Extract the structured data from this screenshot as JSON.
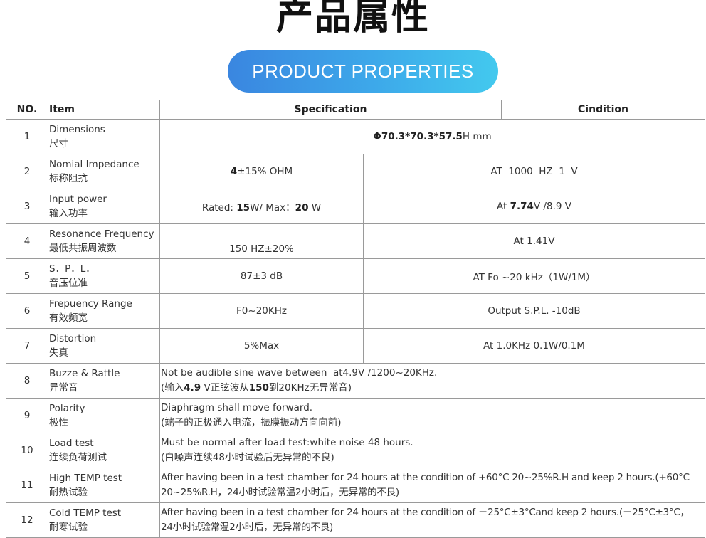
{
  "title_cn": "产品属性",
  "title_en": "PRODUCT PROPERTIES",
  "headers": {
    "no": "NO.",
    "item": "Item",
    "spec": "Specification",
    "cond": "Cindition"
  },
  "rows": [
    {
      "no": "1",
      "item_en": "Dimensions",
      "item_cn": "尺寸",
      "spec_bold": "Φ70.3*70.3*57.5",
      "spec_rest": "H mm"
    },
    {
      "no": "2",
      "item_en": "Nomial Impedance",
      "item_cn": "标称阻抗",
      "spec_bold": "4",
      "spec_rest": "±15% OHM",
      "cond": "AT  1000  HZ  1  V"
    },
    {
      "no": "3",
      "item_en": "Input power",
      "item_cn": "输入功率",
      "spec_a": "Rated: ",
      "spec_b": "15",
      "spec_c": "W/ Max：",
      "spec_d": "20",
      "spec_e": " W",
      "cond_a": "At ",
      "cond_b": "7.74",
      "cond_c": "V /8.9 V"
    },
    {
      "no": "4",
      "item_en": "Resonance Frequency",
      "item_cn": "最低共振周波数",
      "spec": "150 HZ±20%",
      "cond": "At 1.41V"
    },
    {
      "no": "5",
      "item_en": "S．P．L．",
      "item_cn": "音压位准",
      "spec": "87±3 dB",
      "cond": "AT Fo ~20 kHz（1W/1M）"
    },
    {
      "no": "6",
      "item_en": "Frepuency Range",
      "item_cn": "有效频宽",
      "spec": "F0~20KHz",
      "cond": "Output S.P.L. -10dB"
    },
    {
      "no": "7",
      "item_en": "Distortion",
      "item_cn": "失真",
      "spec": "5%Max",
      "cond": "At 1.0KHz 0.1W/0.1M"
    },
    {
      "no": "8",
      "item_en": "Buzze & Rattle",
      "item_cn": "异常音",
      "line1": "Not be audible sine wave between  at4.9V /1200~20KHz.",
      "l2a": "(输入",
      "l2b": "4.9",
      "l2c": " V正弦波从",
      "l2d": "150",
      "l2e": "到20KHz无异常音)"
    },
    {
      "no": "9",
      "item_en": "Polarity",
      "item_cn": "极性",
      "line1": "Diaphragm shall move forward.",
      "line2": "(端子的正极通入电流，振膜振动方向向前)"
    },
    {
      "no": "10",
      "item_en": "Load test",
      "item_cn": "连续负荷测试",
      "line1": "Must be normal after load test:white noise 48 hours.",
      "line2": "(白噪声连续48小时试验后无异常的不良)"
    },
    {
      "no": "11",
      "item_en": "High TEMP test",
      "item_cn": "耐热试验",
      "line1": "After having been in a test chamber for 24 hours at the condition of +60°C 20~25%R.H and keep 2 hours.(+60°C",
      "line2": "20~25%R.H，24小时试验常温2小时后，无异常的不良)"
    },
    {
      "no": "12",
      "item_en": "Cold TEMP test",
      "item_cn": "耐寒试验",
      "line1": "After having been in a test chamber for 24 hours at the condition of －25°C±3°Cand keep 2 hours.(－25°C±3°C，",
      "line2": "24小时试验常温2小时后，无异常的不良)"
    }
  ]
}
